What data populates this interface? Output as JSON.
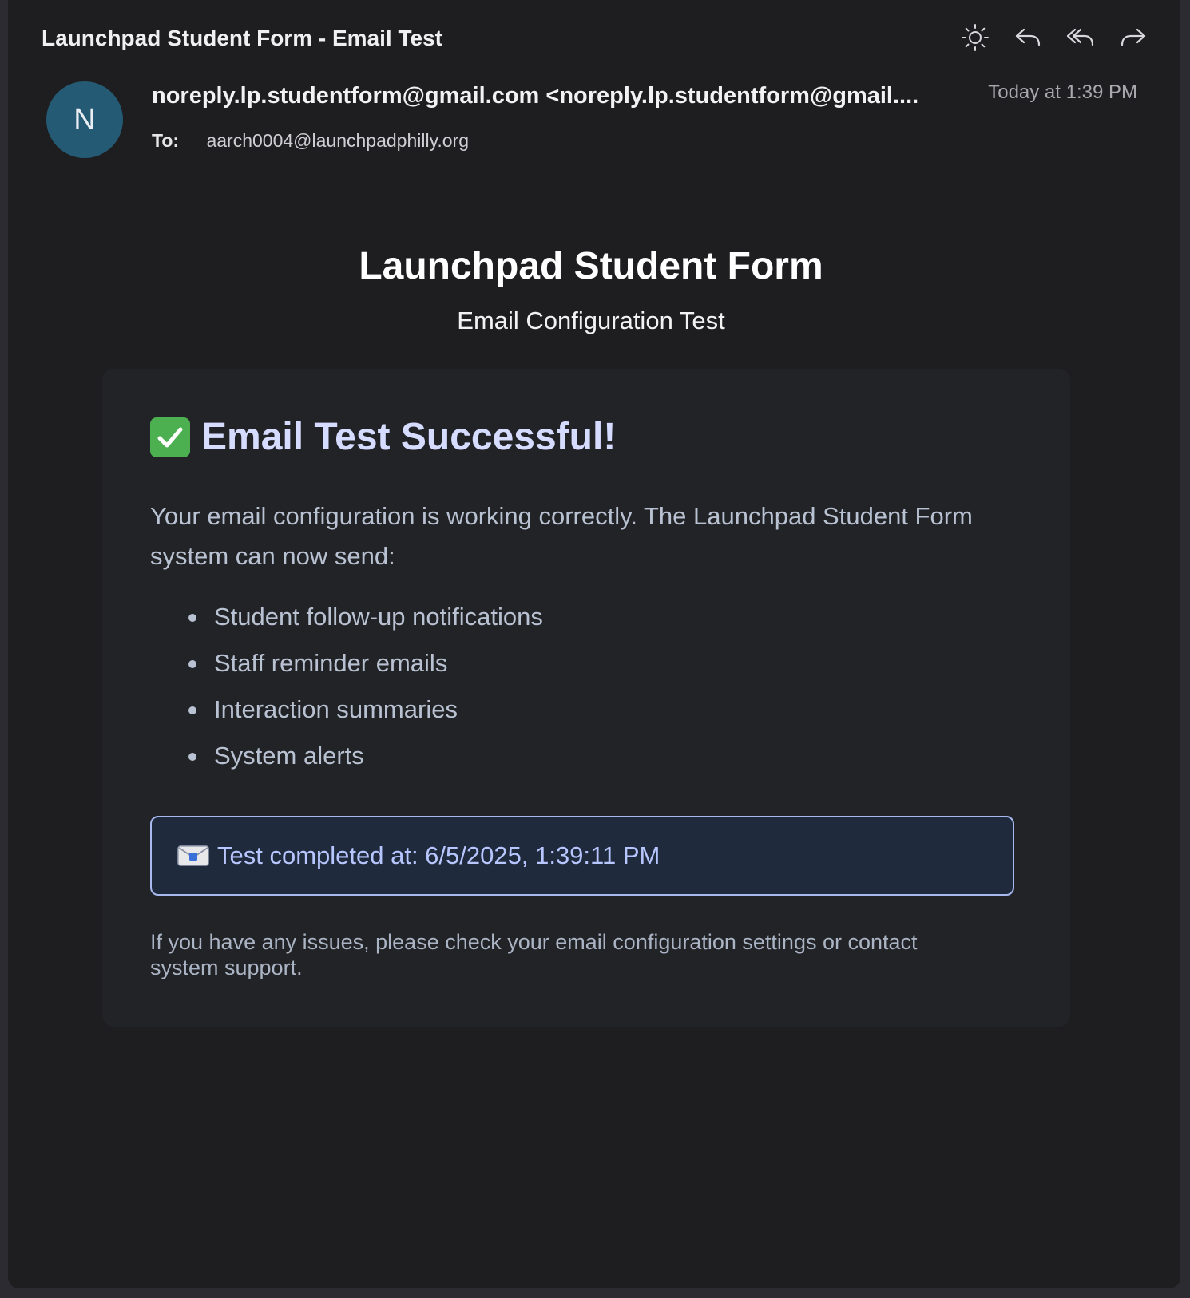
{
  "email": {
    "subject": "Launchpad Student Form - Email Test",
    "toolbar": {
      "icons": [
        "brightness-icon",
        "reply-icon",
        "reply-all-icon",
        "forward-icon"
      ]
    },
    "avatar_initial": "N",
    "from": "noreply.lp.studentform@gmail.com <noreply.lp.studentform@gmail....",
    "date": "Today at 1:39 PM",
    "to_label": "To:",
    "to": "aarch0004@launchpadphilly.org"
  },
  "body": {
    "title": "Launchpad Student Form",
    "subtitle": "Email Configuration Test",
    "card": {
      "heading": "Email Test Successful!",
      "intro": "Your email configuration is working correctly. The Launchpad Student Form system can now send:",
      "features": [
        "Student follow-up notifications",
        "Staff reminder emails",
        "Interaction summaries",
        "System alerts"
      ],
      "notice": "Test completed at: 6/5/2025, 1:39:11 PM",
      "footer": "If you have any issues, please check your email configuration settings or contact system support."
    }
  },
  "colors": {
    "background": "#1e1e20",
    "avatar": "#245a74",
    "heading": "#d6dcff",
    "notice_border": "#a8b9f0",
    "notice_bg": "#1f2a3d",
    "check_green": "#4caf50"
  }
}
